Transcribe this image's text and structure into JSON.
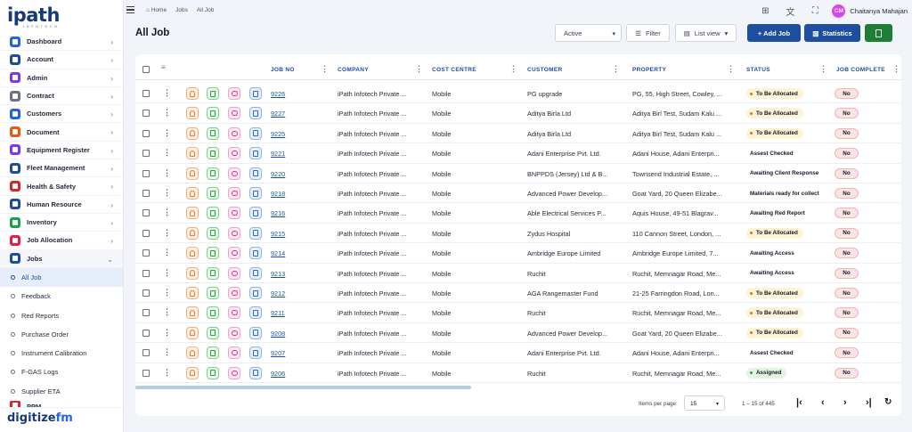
{
  "logo": {
    "main": "ipath",
    "sub": "INFOTECH"
  },
  "brand": {
    "digitize": "digitize",
    "fm": "fm"
  },
  "sidebar": {
    "items": [
      {
        "label": "Dashboard",
        "color": "#2563eb"
      },
      {
        "label": "Account",
        "color": "#1d4f9e"
      },
      {
        "label": "Admin",
        "color": "#7c3aed"
      },
      {
        "label": "Contract",
        "color": "#6b7280"
      },
      {
        "label": "Customers",
        "color": "#2563eb"
      },
      {
        "label": "Document",
        "color": "#ea580c"
      },
      {
        "label": "Equipment Register",
        "color": "#7c3aed"
      },
      {
        "label": "Fleet Management",
        "color": "#1d4f9e"
      },
      {
        "label": "Health & Safety",
        "color": "#dc2626"
      },
      {
        "label": "Human Resource",
        "color": "#1d4f9e"
      },
      {
        "label": "Inventory",
        "color": "#16a34a"
      },
      {
        "label": "Job Allocation",
        "color": "#e11d48"
      },
      {
        "label": "Jobs",
        "color": "#1d4f9e"
      }
    ],
    "subitems": [
      "All Job",
      "Feedback",
      "Red Reports",
      "Purchase Order",
      "Instrument Calibration",
      "F-GAS Logs",
      "Supplier ETA"
    ],
    "partial_item": "PPM"
  },
  "breadcrumb": {
    "home": "Home",
    "jobs": "Jobs",
    "current": "All Job"
  },
  "user": {
    "initials": "CM",
    "name": "Chaitanya Mahajan"
  },
  "page": {
    "title": "All Job"
  },
  "toolbar": {
    "status_value": "Active",
    "filter_label": "Filter",
    "list_view_label": "List view",
    "add_job_label": "+ Add Job",
    "statistics_label": "Statistics"
  },
  "table": {
    "headers": {
      "job_no": "JOB NO",
      "company": "COMPANY",
      "cost_centre": "COST CENTRE",
      "customer": "CUSTOMER",
      "property": "PROPERTY",
      "status": "STATUS",
      "job_complete": "JOB COMPLETE"
    },
    "rows": [
      {
        "job_no": "9226",
        "company": "iPath Infotech Private ...",
        "cost_centre": "Mobile",
        "customer": "PG upgrade",
        "property": "PG, 55, High Street, Cowley, ...",
        "status": "To Be Allocated",
        "status_style": "yellow",
        "job_complete": "No"
      },
      {
        "job_no": "9227",
        "company": "iPath Infotech Private ...",
        "cost_centre": "Mobile",
        "customer": "Aditya Birla Ltd",
        "property": "Aditya Birl Test, Sudam Kalu ...",
        "status": "To Be Allocated",
        "status_style": "yellow",
        "job_complete": "No"
      },
      {
        "job_no": "9225",
        "company": "iPath Infotech Private ...",
        "cost_centre": "Mobile",
        "customer": "Aditya Birla Ltd",
        "property": "Aditya Birl Test, Sudam Kalu ...",
        "status": "To Be Allocated",
        "status_style": "yellow",
        "job_complete": "No"
      },
      {
        "job_no": "9221",
        "company": "iPath Infotech Private ...",
        "cost_centre": "Mobile",
        "customer": "Adani Enterprise Pvt. Ltd.",
        "property": "Adani House, Adani Enterpri...",
        "status": "Assest Checked",
        "status_style": "plain",
        "job_complete": "No"
      },
      {
        "job_no": "9220",
        "company": "iPath Infotech Private ...",
        "cost_centre": "Mobile",
        "customer": "BNPPDS (Jersey) Ltd & B...",
        "property": "Townsend Industrial Estate, ...",
        "status": "Awaiting Client Response",
        "status_style": "plain",
        "job_complete": "No"
      },
      {
        "job_no": "9218",
        "company": "iPath Infotech Private ...",
        "cost_centre": "Mobile",
        "customer": "Advanced Power Develop...",
        "property": "Goat Yard, 20 Queen Elizabe...",
        "status": "Materials ready for collect",
        "status_style": "plain",
        "job_complete": "No"
      },
      {
        "job_no": "9216",
        "company": "iPath Infotech Private ...",
        "cost_centre": "Mobile",
        "customer": "Able Electrical Services P...",
        "property": "Aquis House, 49-51 Blagrav...",
        "status": "Awaiting Red Report",
        "status_style": "plain",
        "job_complete": "No"
      },
      {
        "job_no": "9215",
        "company": "iPath Infotech Private ...",
        "cost_centre": "Mobile",
        "customer": "Zydus Hospital",
        "property": "110 Cannon Street, London, ...",
        "status": "To Be Allocated",
        "status_style": "yellow",
        "job_complete": "No"
      },
      {
        "job_no": "9214",
        "company": "iPath Infotech Private ...",
        "cost_centre": "Mobile",
        "customer": "Ambridge Europe Limited",
        "property": "Ambridge Europe Limited, 7...",
        "status": "Awaiting Access",
        "status_style": "plain",
        "job_complete": "No"
      },
      {
        "job_no": "9213",
        "company": "iPath Infotech Private ...",
        "cost_centre": "Mobile",
        "customer": "Ruchit",
        "property": "Ruchit, Memnagar Road, Me...",
        "status": "Awaiting Access",
        "status_style": "plain",
        "job_complete": "No"
      },
      {
        "job_no": "9212",
        "company": "iPath Infotech Private ...",
        "cost_centre": "Mobile",
        "customer": "AGA Rangemaster Fund",
        "property": "21-25 Farringdon Road, Lon...",
        "status": "To Be Allocated",
        "status_style": "yellow",
        "job_complete": "No"
      },
      {
        "job_no": "9211",
        "company": "iPath Infotech Private ...",
        "cost_centre": "Mobile",
        "customer": "Ruchit",
        "property": "Ruchit, Memnagar Road, Me...",
        "status": "To Be Allocated",
        "status_style": "yellow",
        "job_complete": "No"
      },
      {
        "job_no": "9208",
        "company": "iPath Infotech Private ...",
        "cost_centre": "Mobile",
        "customer": "Advanced Power Develop...",
        "property": "Goat Yard, 20 Queen Elizabe...",
        "status": "To Be Allocated",
        "status_style": "yellow",
        "job_complete": "No"
      },
      {
        "job_no": "9207",
        "company": "iPath Infotech Private ...",
        "cost_centre": "Mobile",
        "customer": "Adani Enterprise Pvt. Ltd.",
        "property": "Adani House, Adani Enterpri...",
        "status": "Assest Checked",
        "status_style": "plain",
        "job_complete": "No"
      },
      {
        "job_no": "9206",
        "company": "iPath Infotech Private ...",
        "cost_centre": "Mobile",
        "customer": "Ruchit",
        "property": "Ruchit, Memnagar Road, Me...",
        "status": "Assigned",
        "status_style": "green",
        "job_complete": "No"
      }
    ]
  },
  "pagination": {
    "items_per_page_label": "Items per page:",
    "page_size": "15",
    "range": "1 – 15 of 445"
  }
}
